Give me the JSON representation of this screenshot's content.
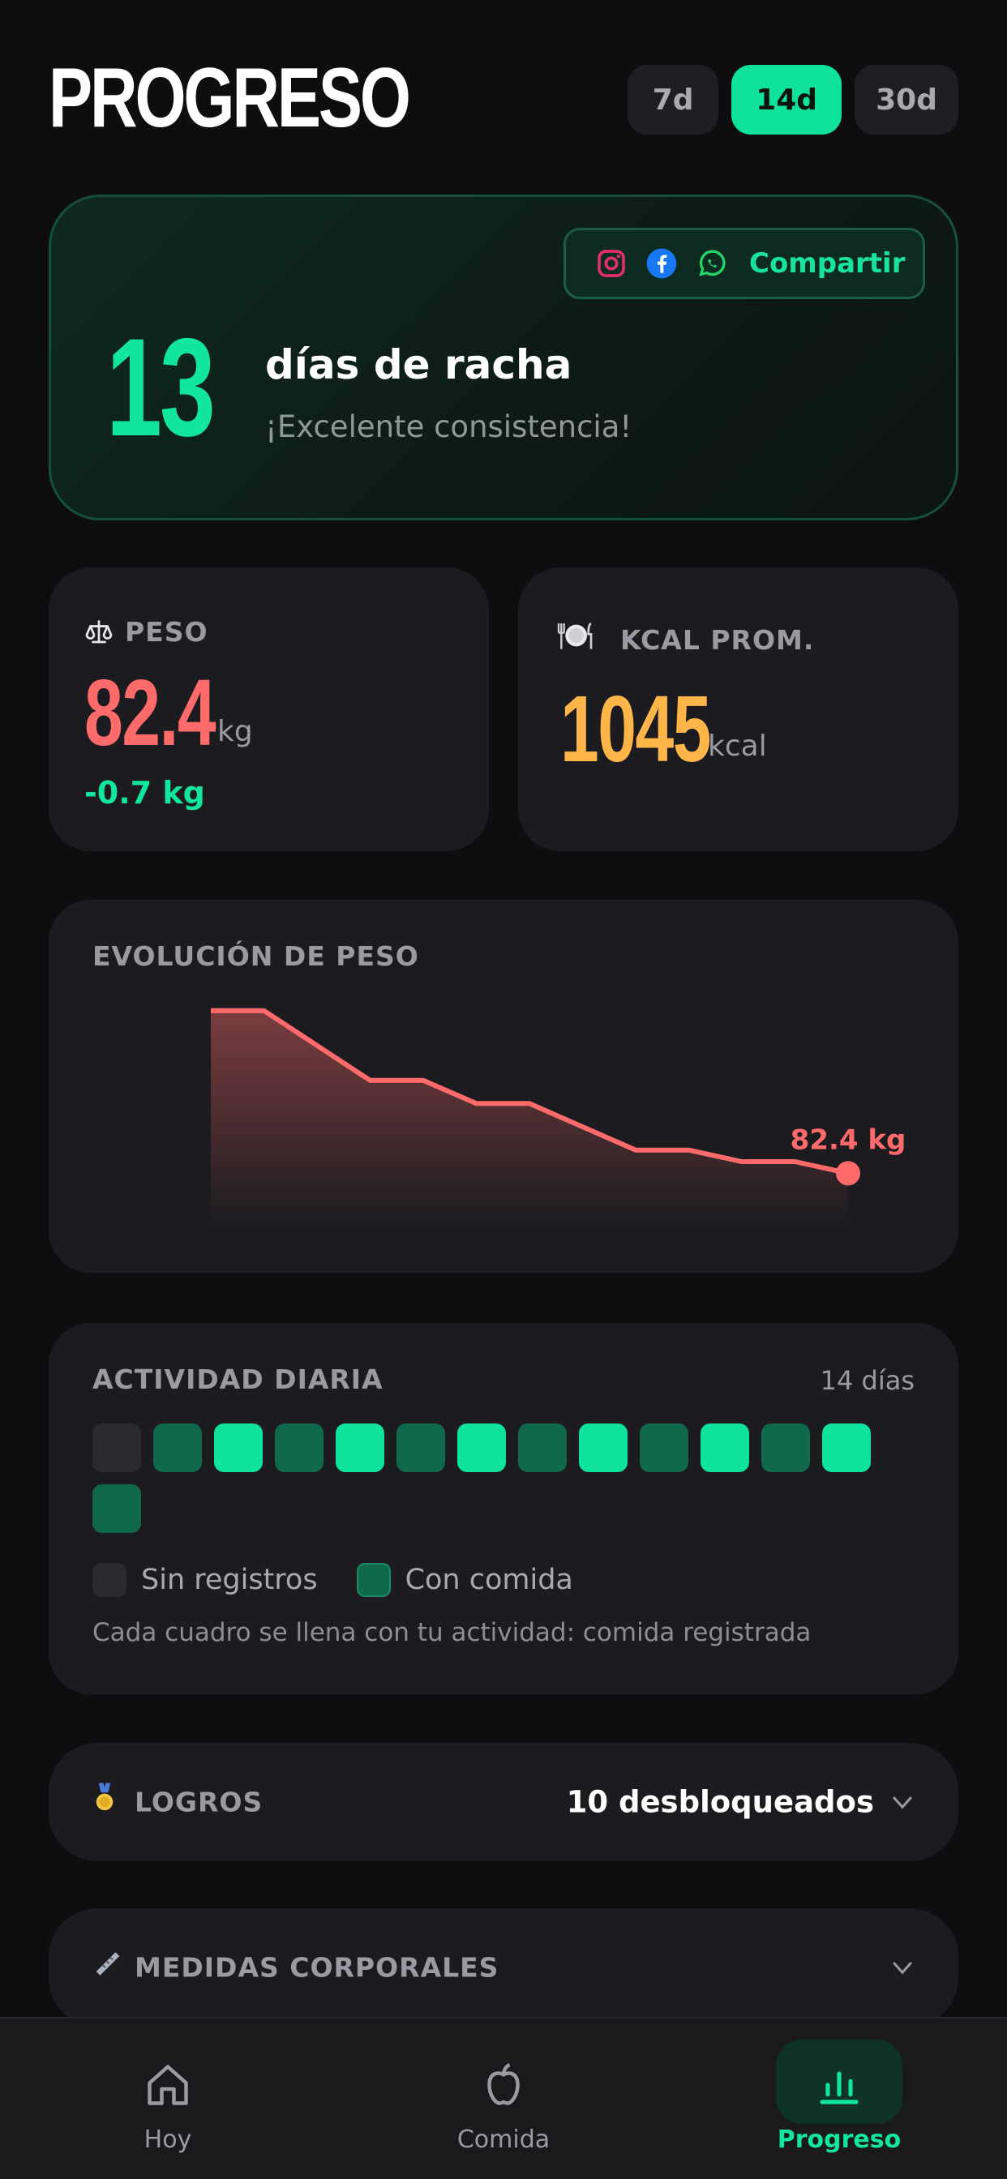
{
  "header": {
    "title": "PROGRESO",
    "ranges": [
      {
        "label": "7d",
        "active": false
      },
      {
        "label": "14d",
        "active": true
      },
      {
        "label": "30d",
        "active": false
      }
    ]
  },
  "streak": {
    "number": "13",
    "label": "días de racha",
    "subtitle": "¡Excelente consistencia!",
    "share_label": "Compartir"
  },
  "weight": {
    "label": "PESO",
    "value": "82.4",
    "unit": "kg",
    "delta": "-0.7 kg"
  },
  "kcal": {
    "label": "KCAL PROM.",
    "value": "1045",
    "unit": "kcal"
  },
  "weight_chart": {
    "title": "EVOLUCIÓN DE PESO",
    "last_label": "82.4 kg",
    "color": "#ff6b6b"
  },
  "chart_data": {
    "type": "area",
    "title": "EVOLUCIÓN DE PESO",
    "series": [
      {
        "values": [
          83.1,
          83.1,
          82.95,
          82.8,
          82.8,
          82.7,
          82.7,
          82.6,
          82.5,
          82.5,
          82.45,
          82.45,
          82.4
        ]
      }
    ],
    "ylim": [
      82.3,
      83.2
    ],
    "grid": false
  },
  "activity": {
    "title": "ACTIVIDAD DIARIA",
    "days_label": "14 días",
    "cells": [
      "none",
      "mid",
      "hi",
      "mid",
      "hi",
      "mid",
      "hi",
      "mid",
      "hi",
      "mid",
      "hi",
      "mid",
      "hi",
      "mid"
    ],
    "legend_none": "Sin registros",
    "legend_food": "Con comida",
    "note": "Cada cuadro se llena con tu actividad: comida registrada"
  },
  "achievements": {
    "label": "LOGROS",
    "value": "10 desbloqueados",
    "icon": "medal-icon"
  },
  "measurements": {
    "label": "MEDIDAS CORPORALES",
    "icon": "ruler-icon"
  },
  "tabbar": {
    "today": "Hoy",
    "food": "Comida",
    "progress": "Progreso"
  },
  "colors": {
    "accent": "#12e59c",
    "weight": "#ff6b6b",
    "kcal": "#ffb547",
    "background": "#0e0e10",
    "card": "#1c1c20"
  }
}
